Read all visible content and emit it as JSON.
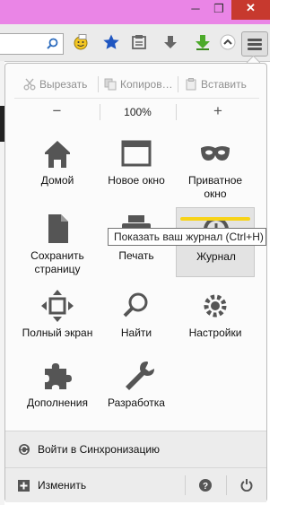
{
  "menu": {
    "cut_label": "Вырезать",
    "copy_label": "Копиров…",
    "paste_label": "Вставить",
    "zoom_out_label": "−",
    "zoom_level": "100%",
    "zoom_in_label": "+",
    "items": [
      {
        "label": "Домой",
        "icon": "home-icon"
      },
      {
        "label": "Новое окно",
        "icon": "new-window-icon"
      },
      {
        "label": "Приватное окно",
        "icon": "private-window-icon"
      },
      {
        "label": "Сохранить страницу",
        "icon": "save-page-icon"
      },
      {
        "label": "Печать",
        "icon": "print-icon"
      },
      {
        "label": "Журнал",
        "icon": "history-icon"
      },
      {
        "label": "Полный экран",
        "icon": "fullscreen-icon"
      },
      {
        "label": "Найти",
        "icon": "find-icon"
      },
      {
        "label": "Настройки",
        "icon": "settings-icon"
      },
      {
        "label": "Дополнения",
        "icon": "addons-icon"
      },
      {
        "label": "Разработка",
        "icon": "developer-icon"
      }
    ],
    "sync_label": "Войти в Синхронизацию",
    "customize_label": "Изменить"
  },
  "tooltip": {
    "text": "Показать ваш журнал (Ctrl+H)"
  },
  "window": {
    "minimize": "─",
    "maximize": "❐",
    "close": "✕"
  },
  "colors": {
    "titlebar": "#ea85e6",
    "highlight": "#f7d318",
    "close": "#c7392e"
  }
}
